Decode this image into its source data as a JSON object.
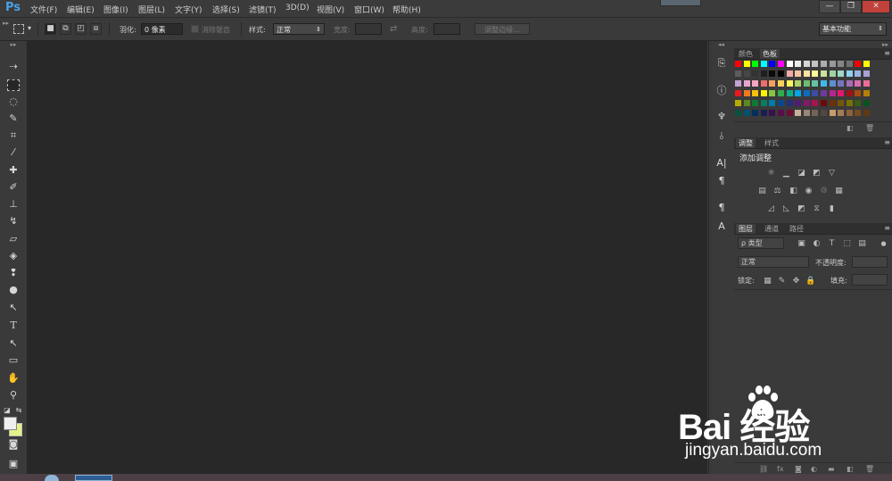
{
  "app": {
    "logo": "Ps"
  },
  "menu": [
    "文件(F)",
    "编辑(E)",
    "图像(I)",
    "图层(L)",
    "文字(Y)",
    "选择(S)",
    "滤镜(T)",
    "3D(D)",
    "视图(V)",
    "窗口(W)",
    "帮助(H)"
  ],
  "window_controls": {
    "minimize": "—",
    "restore": "❐",
    "close": "✕"
  },
  "options": {
    "feather_label": "羽化:",
    "feather_value": "0 像素",
    "antialias_label": "消除锯齿",
    "style_label": "样式:",
    "style_value": "正常",
    "width_label": "宽度:",
    "height_label": "高度:",
    "refine_edge": "调整边缘...",
    "workspace": "基本功能"
  },
  "panels": {
    "color_tabs": [
      "颜色",
      "色板"
    ],
    "adjust_tabs": [
      "调整",
      "样式"
    ],
    "add_adjustment": "添加调整",
    "layers_tabs": [
      "图层",
      "通道",
      "路径"
    ],
    "kind_filter": "ρ 类型",
    "blend_mode": "正常",
    "opacity_label": "不透明度:",
    "lock_label": "锁定:",
    "fill_label": "填充:"
  },
  "swatch_colors": [
    [
      "#ff0000",
      "#ffff00",
      "#00ff00",
      "#00ffff",
      "#0000ff",
      "#ff00ff",
      "#ffffff",
      "#ebebeb",
      "#d6d6d6",
      "#c2c2c2",
      "#adadad",
      "#999999",
      "#858585",
      "#707070",
      "#ff0000",
      "#ffff00"
    ],
    [
      "#5c5c5c",
      "#474747",
      "#333333",
      "#1f1f1f",
      "#0a0a0a",
      "#000000",
      "#f4a8a8",
      "#f7c6a0",
      "#fbe29f",
      "#fefb9a",
      "#c9e39c",
      "#9fd59f",
      "#9dd7c5",
      "#8fd2f0",
      "#9ab4e0",
      "#a9a2d6"
    ],
    [
      "#c4a2d2",
      "#e8a5cd",
      "#f4a7c0",
      "#ef6c6c",
      "#f59f63",
      "#fcd05c",
      "#fef65a",
      "#aed36a",
      "#6cbd6e",
      "#66c2a1",
      "#3fb8ec",
      "#5d8ed0",
      "#7674c0",
      "#a36eb5",
      "#d76dae",
      "#ea6c97"
    ],
    [
      "#e51b1b",
      "#ee7a1f",
      "#f9bd0c",
      "#fef204",
      "#89c43f",
      "#2fac4d",
      "#10ad86",
      "#00a6e6",
      "#0f6bbd",
      "#3e4ca5",
      "#6f3a9a",
      "#b1278e",
      "#e3186b",
      "#a50f14",
      "#a84c0f",
      "#b38009"
    ],
    [
      "#b6ac00",
      "#5b8a21",
      "#117a32",
      "#0a7c5f",
      "#007ca6",
      "#08488a",
      "#262e7a",
      "#4f1d71",
      "#811a6a",
      "#a9124f",
      "#6d090b",
      "#6e3209",
      "#755505",
      "#787100",
      "#3a5c16",
      "#0b5221"
    ],
    [
      "#06523f",
      "#005270",
      "#042f5d",
      "#191d52",
      "#35124b",
      "#570f47",
      "#720a35",
      "#c7b299",
      "#998675",
      "#736357",
      "#534741",
      "#c69c6d",
      "#a67c52",
      "#8c6239",
      "#754c24",
      "#603913"
    ]
  ],
  "watermark": {
    "brand": "Bai 经验",
    "url": "jingyan.baidu.com"
  }
}
